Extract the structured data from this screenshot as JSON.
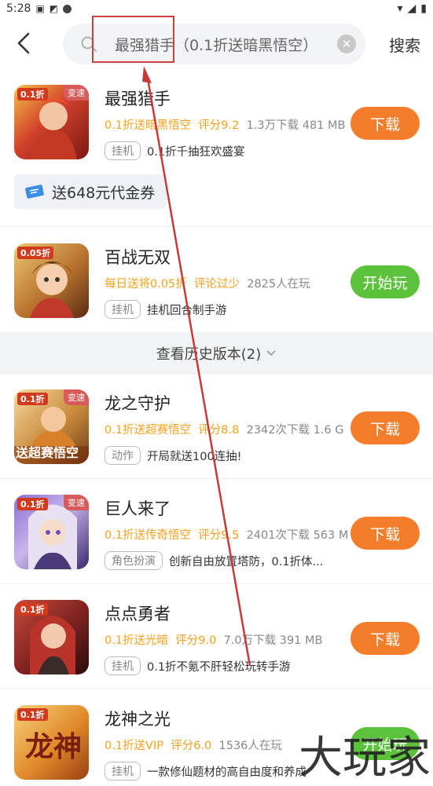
{
  "status": {
    "time": "5:28"
  },
  "search": {
    "query": "最强猎手（0.1折送暗黑悟空）",
    "search_label": "搜索"
  },
  "games": [
    {
      "name": "最强猎手",
      "promo": "0.1折送暗黑悟空",
      "rating": "评分9.2",
      "stats": "1.3万下载  481 MB",
      "tag": "挂机",
      "desc": "0.1折千抽狂欢盛宴",
      "button": "下载",
      "corner": "0.1折",
      "badge": "变速"
    },
    {
      "name": "百战无双",
      "promo": "每日送将0.05折",
      "rating": "评论过少",
      "stats": "2825人在玩",
      "tag": "挂机",
      "desc": "挂机回合制手游",
      "button": "开始玩",
      "corner": "0.05折"
    },
    {
      "name": "龙之守护",
      "promo": "0.1折送超赛悟空",
      "rating": "评分8.8",
      "stats": "2342次下载  1.6 G",
      "tag": "动作",
      "desc": "开局就送100连抽!",
      "button": "下载",
      "corner": "0.1折",
      "badge": "变速",
      "icon_text": "送超赛悟空"
    },
    {
      "name": "巨人来了",
      "promo": "0.1折送传奇悟空",
      "rating": "评分9.5",
      "stats": "2401次下载  563 M",
      "tag": "角色扮演",
      "desc": "创新自由放置塔防，0.1折体...",
      "button": "下载",
      "corner": "0.1折",
      "badge": "变速"
    },
    {
      "name": "点点勇者",
      "promo": "0.1折送光暗",
      "rating": "评分9.0",
      "stats": "7.0万下载  391 MB",
      "tag": "挂机",
      "desc": "0.1折不氪不肝轻松玩转手游",
      "button": "下载",
      "corner": "0.1折"
    },
    {
      "name": "龙神之光",
      "promo": "0.1折送VIP",
      "rating": "评分6.0",
      "stats": "1536人在玩",
      "tag": "挂机",
      "desc": "一款修仙题材的高自由度和养成",
      "button": "开始玩",
      "corner": "0.1折",
      "icon_text": "龙神"
    }
  ],
  "coupon": {
    "text": "送648元代金券"
  },
  "history": {
    "label": "查看历史版本(2)"
  },
  "watermark": {
    "text": "大玩家"
  },
  "colors": {
    "orange": "#f47d2b",
    "green": "#5cc23c",
    "promo": "#f4a21e",
    "annotation": "#d04040"
  }
}
